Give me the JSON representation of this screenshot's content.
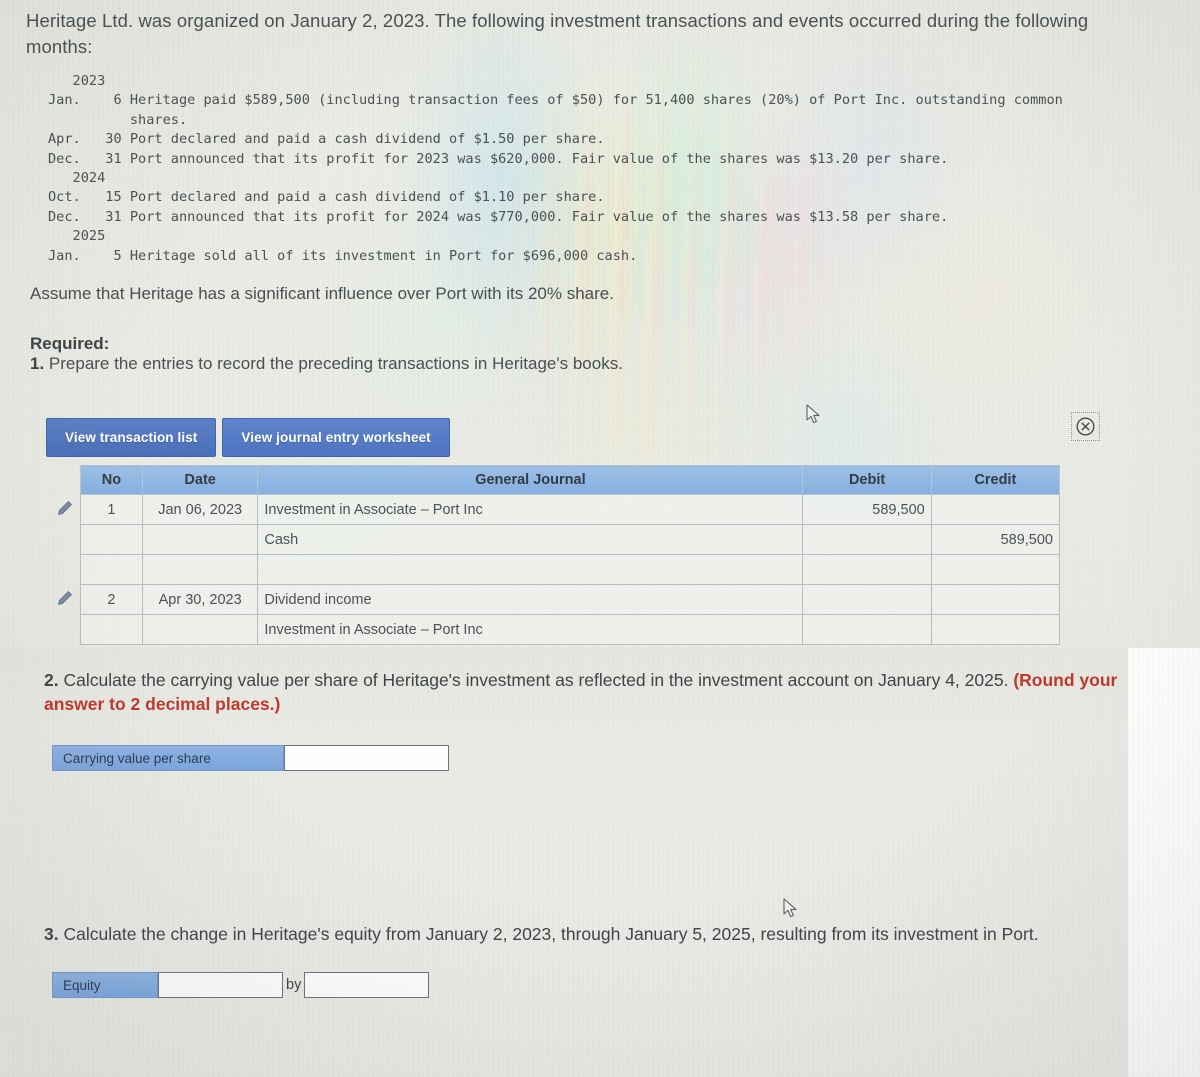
{
  "intro": {
    "text": "Heritage Ltd. was organized on January 2, 2023. The following investment transactions and events occurred during the following months:"
  },
  "transactions": {
    "lines": [
      "   2023",
      "Jan.    6 Heritage paid $589,500 (including transaction fees of $50) for 51,400 shares (20%) of Port Inc. outstanding common",
      "          shares.",
      "Apr.   30 Port declared and paid a cash dividend of $1.50 per share.",
      "Dec.   31 Port announced that its profit for 2023 was $620,000. Fair value of the shares was $13.20 per share.",
      "   2024",
      "Oct.   15 Port declared and paid a cash dividend of $1.10 per share.",
      "Dec.   31 Port announced that its profit for 2024 was $770,000. Fair value of the shares was $13.58 per share.",
      "   2025",
      "Jan.    5 Heritage sold all of its investment in Port for $696,000 cash."
    ]
  },
  "assumption": {
    "text": "Assume that Heritage has a significant influence over Port with its 20% share."
  },
  "required": {
    "label": "Required:",
    "item1_number": "1.",
    "item1_text": " Prepare the entries to record the preceding transactions in Heritage's books."
  },
  "tabs": [
    {
      "label": "View transaction list",
      "active": false
    },
    {
      "label": "View journal entry worksheet",
      "active": true
    }
  ],
  "close_icon": {
    "name": "close-circle-icon",
    "glyph": "⊗"
  },
  "journal": {
    "headers": {
      "no": "No",
      "date": "Date",
      "general_journal": "General Journal",
      "debit": "Debit",
      "credit": "Credit"
    },
    "rows": [
      {
        "editable": true,
        "no": "1",
        "date": "Jan 06, 2023",
        "account": "Investment in Associate – Port Inc",
        "indent": false,
        "debit": "589,500",
        "credit": ""
      },
      {
        "editable": false,
        "no": "",
        "date": "",
        "account": "Cash",
        "indent": true,
        "debit": "",
        "credit": "589,500"
      },
      {
        "editable": false,
        "no": "",
        "date": "",
        "account": "",
        "indent": false,
        "debit": "",
        "credit": ""
      },
      {
        "editable": true,
        "no": "2",
        "date": "Apr 30, 2023",
        "account": "Dividend income",
        "indent": false,
        "debit": "",
        "credit": ""
      },
      {
        "editable": false,
        "no": "",
        "date": "",
        "account": "Investment in Associate – Port Inc",
        "indent": true,
        "debit": "",
        "credit": ""
      }
    ]
  },
  "question2": {
    "number": "2.",
    "text": " Calculate the carrying value per share of Heritage's investment as reflected in the investment account on January 4, 2025. ",
    "round_note": "(Round your answer to 2 decimal places.)",
    "answer": {
      "label": "Carrying value per share",
      "value": "",
      "placeholder": ""
    }
  },
  "question3": {
    "number": "3.",
    "text": " Calculate the change in Heritage's equity from January 2, 2023, through January 5, 2025, resulting from its investment in Port.",
    "answer": {
      "label": "Equity",
      "value1": "",
      "connector": "by",
      "value2": "",
      "placeholder": ""
    }
  },
  "colors": {
    "tab_blue": "#4a6fba",
    "header_blue": "#85afdf",
    "label_blue": "#7ba6dd",
    "warning_red": "#c0392b",
    "body_text": "#4a4f52",
    "page_bg": "#e9eae4"
  }
}
